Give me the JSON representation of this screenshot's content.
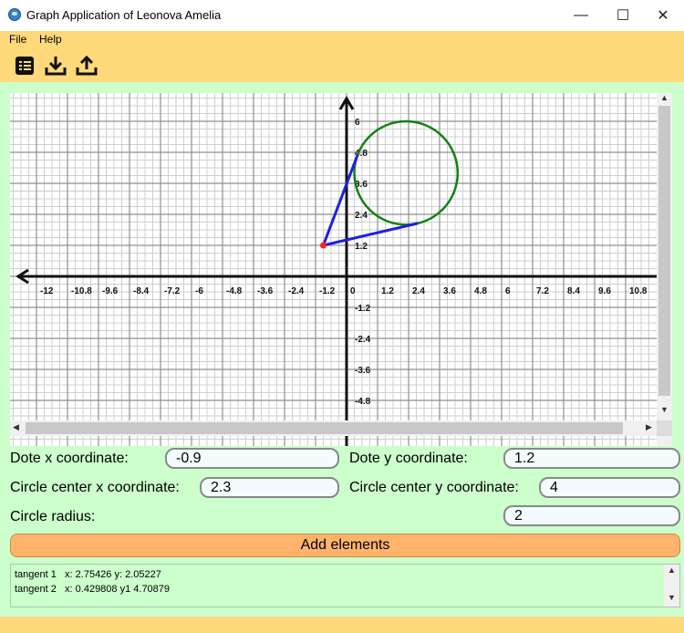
{
  "window": {
    "title": "Graph Application of Leonova Amelia",
    "minimize_glyph": "—",
    "maximize_glyph": "☐",
    "close_glyph": "✕"
  },
  "menu": {
    "items": [
      "File",
      "Help"
    ]
  },
  "toolbar": {
    "icons": [
      "list-icon",
      "download-icon",
      "upload-icon"
    ]
  },
  "colors": {
    "accent": "#ffd97a",
    "panel": "#ccffcc",
    "button": "#ffb36b",
    "circle": "#148014",
    "tangent": "#1f1fe0",
    "point": "#ff2020"
  },
  "graph": {
    "x_ticks": [
      "-12",
      "-10.8",
      "-9.6",
      "-8.4",
      "-7.2",
      "-6",
      "-4.8",
      "-3.6",
      "-2.4",
      "-1.2",
      "0",
      "1.2",
      "2.4",
      "3.6",
      "4.8",
      "6",
      "7.2",
      "8.4",
      "9.6",
      "10.8"
    ],
    "y_ticks_positive": [
      "6",
      "4.8",
      "3.6",
      "2.4",
      "1.2"
    ],
    "y_ticks_negative": [
      "-1.2",
      "-2.4",
      "-3.6",
      "-4.8"
    ],
    "point": {
      "x": -0.9,
      "y": 1.2
    },
    "circle": {
      "cx": 2.3,
      "cy": 4,
      "r": 2
    },
    "tangent_points": [
      {
        "x": 2.75426,
        "y": 2.05227
      },
      {
        "x": 0.429808,
        "y": 4.70879
      }
    ]
  },
  "form": {
    "dot_x_label": "Dote x coordinate:",
    "dot_x_value": "-0.9",
    "dot_y_label": "Dote y coordinate:",
    "dot_y_value": "1.2",
    "cx_label": "Circle center x coordinate:",
    "cx_value": "2.3",
    "cy_label": "Circle center y coordinate:",
    "cy_value": "4",
    "radius_label": "Circle radius:",
    "radius_value": "2",
    "add_button": "Add elements"
  },
  "log": {
    "lines": [
      "tangent 1   x: 2.75426 y: 2.05227",
      "tangent 2   x: 0.429808 y1 4.70879"
    ]
  }
}
